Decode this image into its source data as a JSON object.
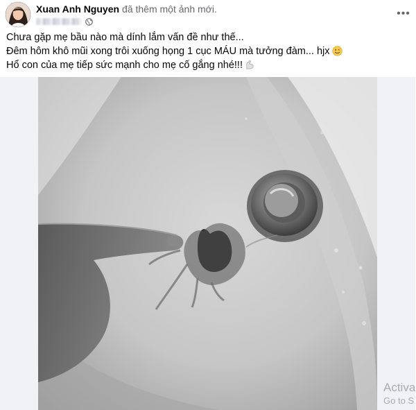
{
  "post": {
    "author_name": "Xuan Anh Nguyen",
    "action_text": "đã thêm một ảnh mới.",
    "more_label": "•••",
    "caption_lines": [
      "Chưa gặp mẹ bầu nào mà dính lắm vấn đề như thế...",
      "Đêm hôm khô mũi xong trôi xuống họng 1 cục MÁU mà tưởng đàm... hjx",
      "Hổ con của mẹ tiếp sức mạnh cho mẹ cố gắng nhé!!!"
    ],
    "icons": {
      "privacy": "globe-icon",
      "line2_emoji": "smiling-face-emoji-icon",
      "line3_emoji": "flexed-biceps-emoji-icon",
      "menu": "more-options-icon"
    }
  },
  "watermark": {
    "line1": "Activa",
    "line2": "Go to S"
  },
  "colors": {
    "secondary_text": "#65676b",
    "primary_text": "#050505",
    "side_strip": "#f0f2f5"
  }
}
